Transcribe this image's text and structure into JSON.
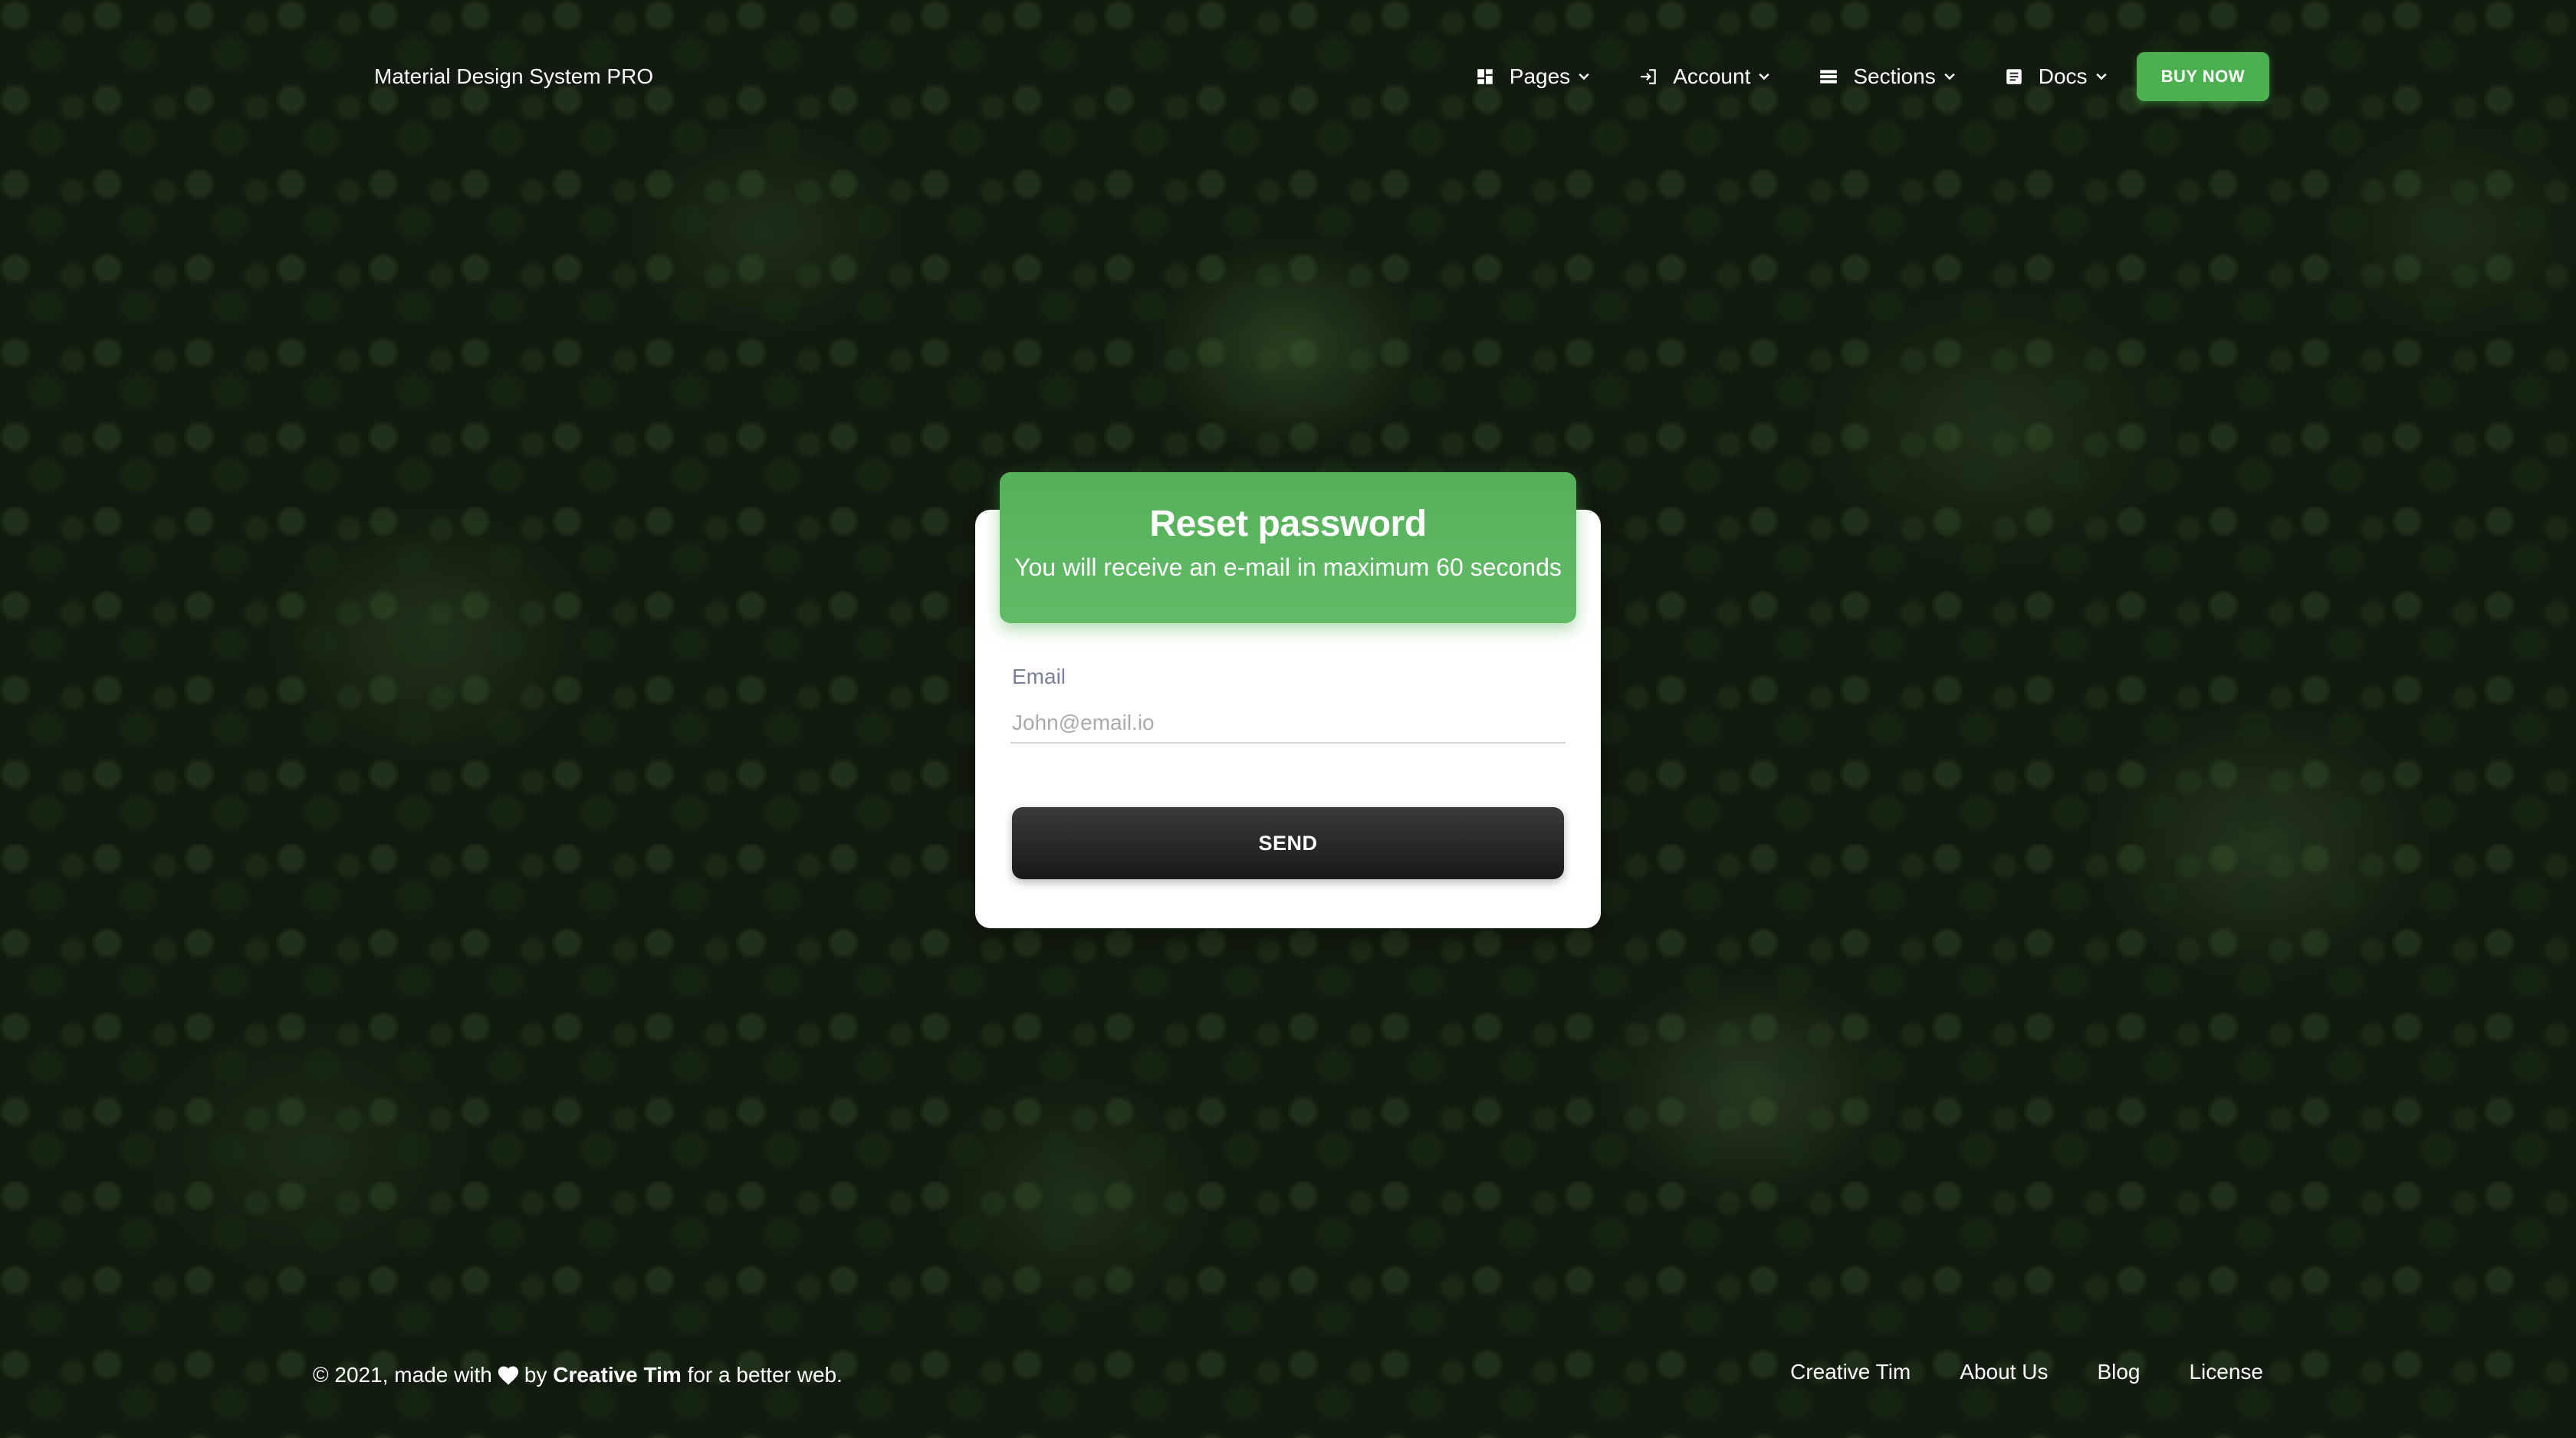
{
  "navbar": {
    "brand": "Material Design System PRO",
    "items": [
      {
        "label": "Pages",
        "icon": "dashboard-icon"
      },
      {
        "label": "Account",
        "icon": "login-icon"
      },
      {
        "label": "Sections",
        "icon": "view-list-icon"
      },
      {
        "label": "Docs",
        "icon": "article-icon"
      }
    ],
    "buy_label": "BUY NOW"
  },
  "card": {
    "title": "Reset password",
    "subtitle": "You will receive an e-mail in maximum 60 seconds",
    "email_label": "Email",
    "email_placeholder": "John@email.io",
    "send_label": "SEND"
  },
  "footer": {
    "copyright_prefix": "© 2021, made with",
    "by_text": "by",
    "author": "Creative Tim",
    "suffix": "for a better web.",
    "links": [
      "Creative Tim",
      "About Us",
      "Blog",
      "License"
    ]
  },
  "colors": {
    "accent": "#4caf50",
    "dark_button": "#191919",
    "label": "#7b809a"
  }
}
